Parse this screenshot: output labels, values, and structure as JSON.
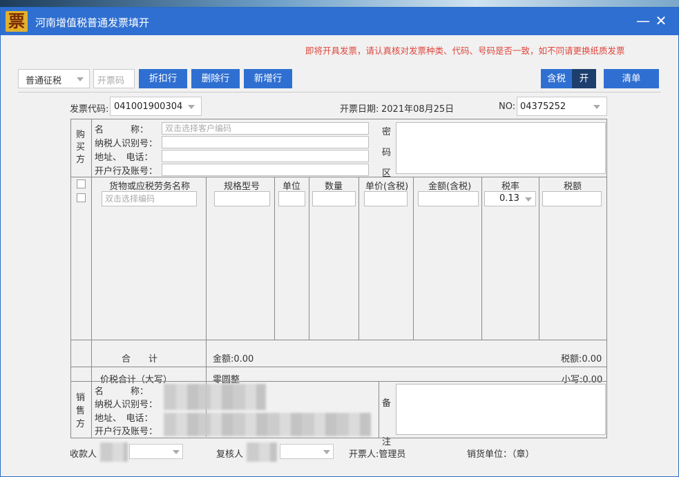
{
  "window": {
    "logo": "票",
    "title": "河南增值税普通发票填开",
    "minimize": "—",
    "close": "✕"
  },
  "notice": "即将开具发票，请认真核对发票种类、代码、号码是否一致，如不同请更换纸质发票",
  "toolbar": {
    "tax_type": "普通征税",
    "ticket_code_placeholder": "开票码",
    "discount": "折扣行",
    "delete_row": "删除行",
    "add_row": "新增行",
    "tax_incl": "含税",
    "toggle_state": "开",
    "list": "清单"
  },
  "header": {
    "code_label": "发票代码:",
    "code_value": "041001900304",
    "date_label": "开票日期:",
    "date_value": "2021年08月25日",
    "no_label": "NO:",
    "no_value": "04375252"
  },
  "buyer": {
    "side_label": "购买方",
    "name_label": "名　　　称：",
    "name_placeholder": "双击选择客户编码",
    "taxid_label": "纳税人识别号：",
    "addr_label": "地址、　电话：",
    "bank_label": "开户行及账号：",
    "secret_label": "密码区"
  },
  "items": {
    "columns": [
      "货物或应税劳务名称",
      "规格型号",
      "单位",
      "数量",
      "单价(含税)",
      "金额(含税)",
      "税率",
      "税额"
    ],
    "name_placeholder": "双击选择编码",
    "tax_rate": "0.13"
  },
  "totals": {
    "label": "合　　计",
    "amount": "金额:0.00",
    "tax": "税额:0.00"
  },
  "grand": {
    "label": "价税合计（大写）",
    "uppercase": "零圆整",
    "lowercase": "小写:0.00"
  },
  "seller": {
    "side_label": "销售方",
    "name_label": "名　　　称：",
    "taxid_label": "纳税人识别号：",
    "addr_label": "地址、　电话：",
    "bank_label": "开户行及账号：",
    "remark_label": "备注"
  },
  "footer": {
    "payee": "收款人",
    "reviewer": "复核人",
    "drawer": "开票人:管理员",
    "seller_unit": "销货单位：（章）"
  }
}
